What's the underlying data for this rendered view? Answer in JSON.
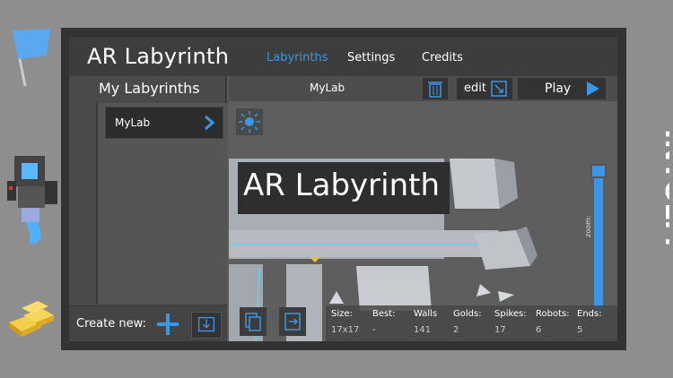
{
  "header": {
    "title": "AR Labyrinth",
    "tabs": [
      {
        "label": "Labyrinths",
        "active": true
      },
      {
        "label": "Settings",
        "active": false
      },
      {
        "label": "Credits",
        "active": false
      }
    ]
  },
  "sidebar": {
    "title": "My Labyrinths",
    "items": [
      {
        "label": "MyLab"
      }
    ],
    "create_label": "Create new:"
  },
  "main": {
    "lab_name": "MyLab",
    "edit_label": "edit",
    "play_label": "Play",
    "overlay_title": "AR Labyrinth",
    "zoom_label": "zoom:",
    "zoom_level": 0.95
  },
  "stats": [
    {
      "label": "Size:",
      "value": "17x17"
    },
    {
      "label": "Best:",
      "value": "-"
    },
    {
      "label": "Walls",
      "value": "141"
    },
    {
      "label": "Golds:",
      "value": "2"
    },
    {
      "label": "Spikes:",
      "value": "17"
    },
    {
      "label": "Robots:",
      "value": "6"
    },
    {
      "label": "Ends:",
      "value": "5"
    }
  ],
  "brand": {
    "text": "INTOLM"
  },
  "colors": {
    "accent": "#3a96e6",
    "gold": "#e8c23a"
  },
  "icons": [
    "flag-icon",
    "robot-icon",
    "gold-bars-icon",
    "chevron-right-icon",
    "plus-icon",
    "import-icon",
    "trash-icon",
    "edit-icon",
    "play-icon",
    "sun-icon",
    "copy-icon",
    "export-icon"
  ]
}
